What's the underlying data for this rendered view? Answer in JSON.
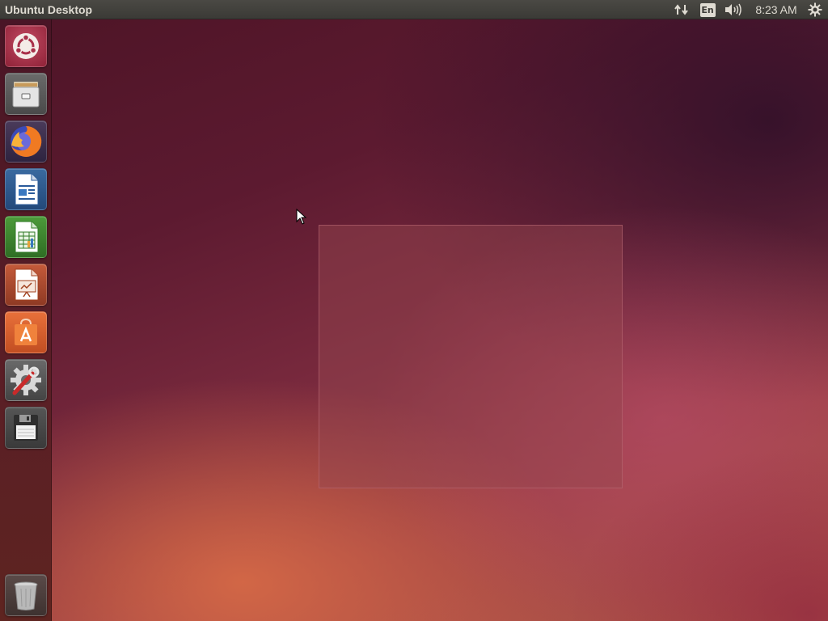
{
  "top_panel": {
    "title": "Ubuntu Desktop",
    "keyboard_layout": "En",
    "clock": "8:23 AM",
    "indicators": [
      "network-icon",
      "keyboard-layout-indicator",
      "volume-icon",
      "clock",
      "gear-icon"
    ]
  },
  "launcher": {
    "items": [
      {
        "name": "dash-home",
        "icon": "ubuntu-logo-icon"
      },
      {
        "name": "files",
        "icon": "file-cabinet-icon"
      },
      {
        "name": "firefox",
        "icon": "firefox-icon"
      },
      {
        "name": "libreoffice-writer",
        "icon": "writer-document-icon"
      },
      {
        "name": "libreoffice-calc",
        "icon": "calc-spreadsheet-icon"
      },
      {
        "name": "libreoffice-impress",
        "icon": "impress-presentation-icon"
      },
      {
        "name": "ubuntu-software",
        "icon": "software-bag-icon"
      },
      {
        "name": "system-settings",
        "icon": "settings-gear-wrench-icon"
      },
      {
        "name": "disk",
        "icon": "floppy-disk-icon"
      },
      {
        "name": "trash",
        "icon": "trash-can-icon"
      }
    ]
  },
  "colors": {
    "panel_bg": "#3b3a36",
    "panel_text": "#dfdbd2",
    "wallpaper_dark": "#4d1426",
    "wallpaper_light": "#b55a48"
  }
}
